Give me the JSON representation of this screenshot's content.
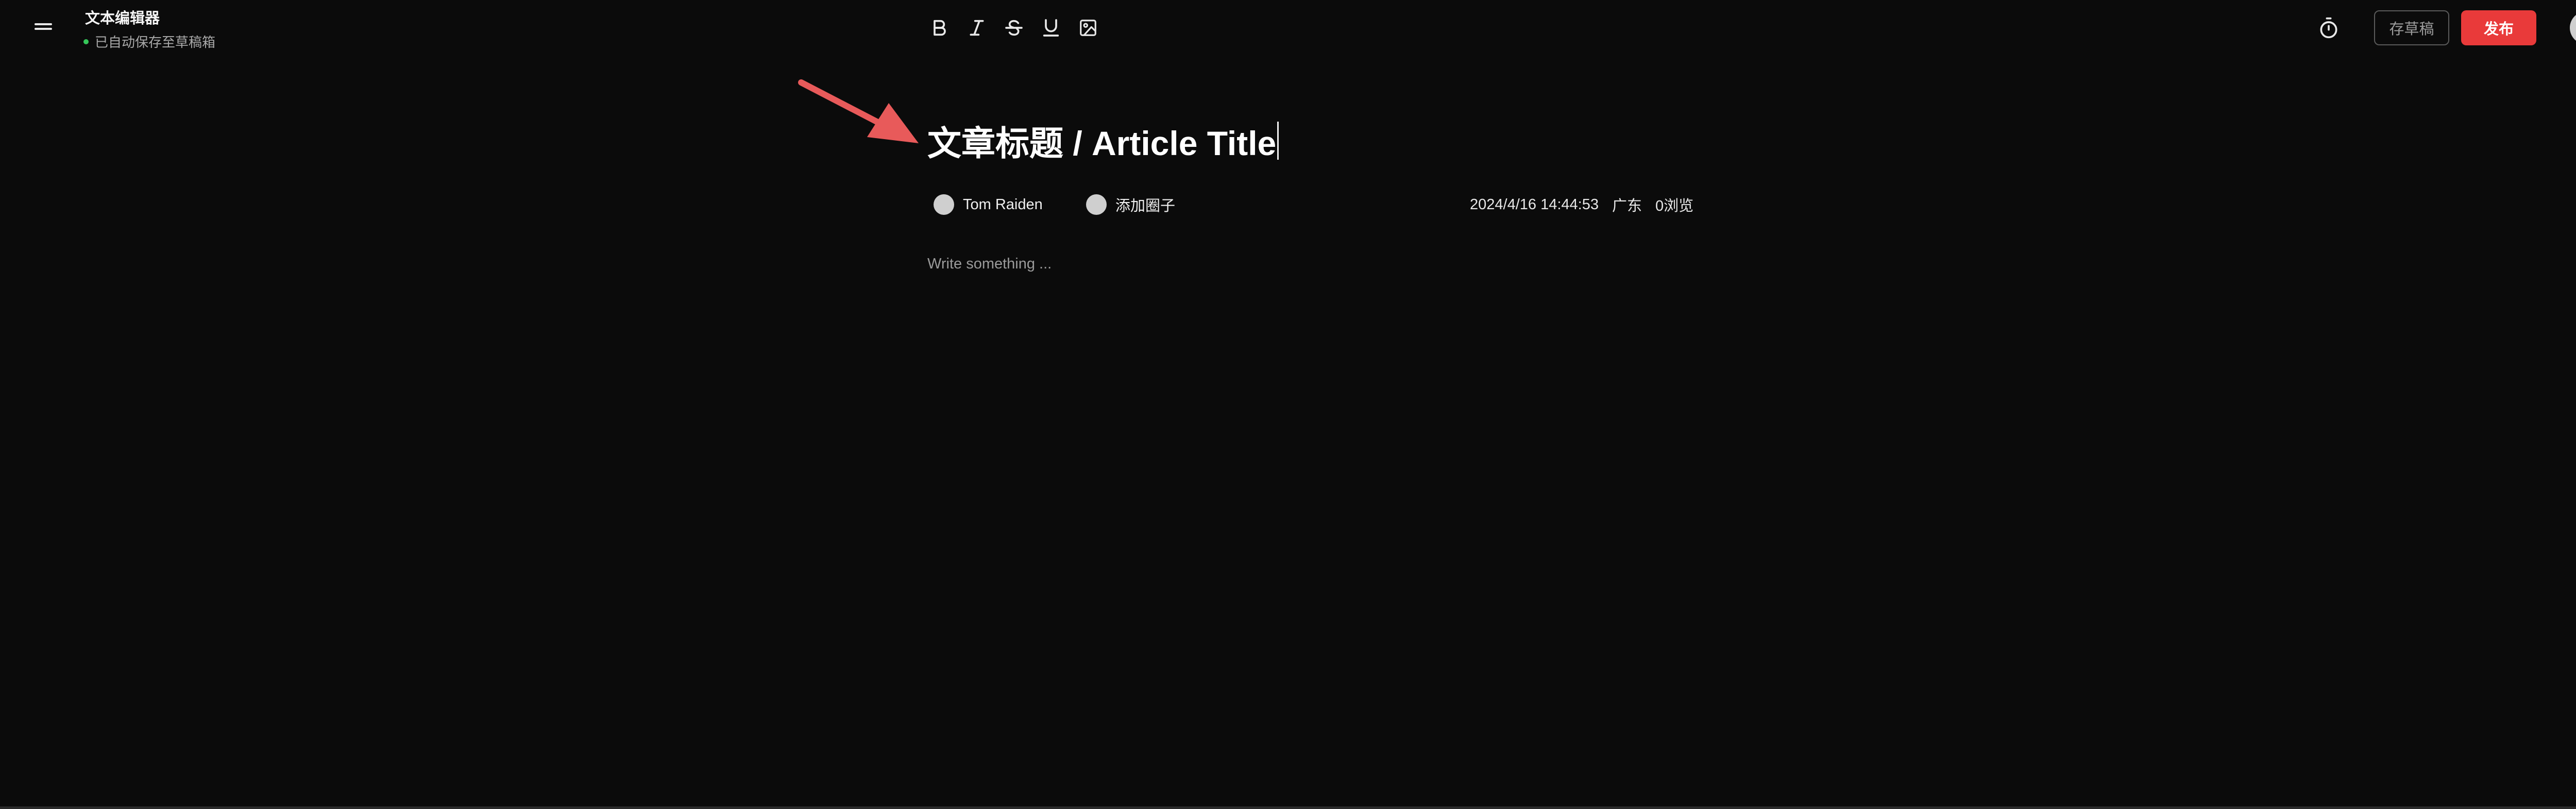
{
  "header": {
    "menu_icon": "hamburger-menu-icon",
    "app_title": "文本编辑器",
    "save_status": "已自动保存至草稿箱",
    "status_color": "#35c759"
  },
  "toolbar": {
    "tools": [
      {
        "name": "bold",
        "icon": "bold-icon"
      },
      {
        "name": "italic",
        "icon": "italic-icon"
      },
      {
        "name": "strikethrough",
        "icon": "strikethrough-icon"
      },
      {
        "name": "underline",
        "icon": "underline-icon"
      },
      {
        "name": "image",
        "icon": "image-icon"
      }
    ]
  },
  "actions": {
    "timer_icon": "timer-icon",
    "draft_label": "存草稿",
    "publish_label": "发布",
    "publish_color": "#e93a3a"
  },
  "article": {
    "title": "文章标题 / Article Title",
    "author": "Tom Raiden",
    "add_circle_label": "添加圈子",
    "datetime": "2024/4/16 14:44:53",
    "location": "广东",
    "views": "0浏览",
    "body_placeholder": "Write something ..."
  },
  "annotation": {
    "arrow_color": "#e85a5a"
  }
}
